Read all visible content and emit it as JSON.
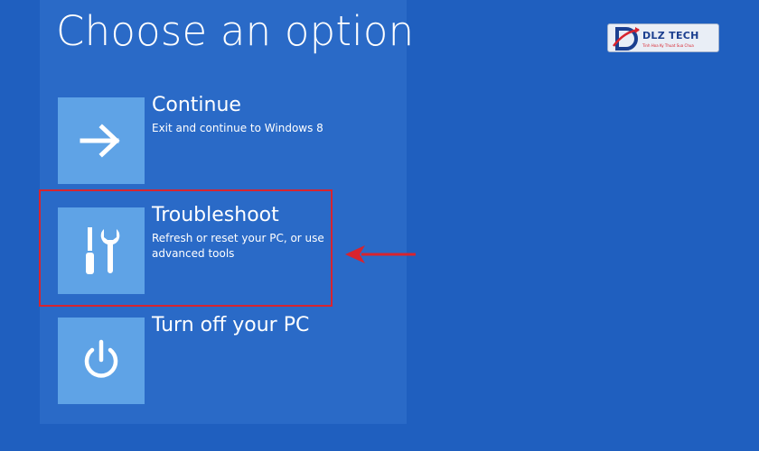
{
  "page": {
    "title": "Choose an option"
  },
  "options": [
    {
      "title": "Continue",
      "description": "Exit and continue to Windows 8",
      "icon": "arrow-right-icon"
    },
    {
      "title": "Troubleshoot",
      "description": "Refresh or reset your PC, or use advanced tools",
      "icon": "tools-icon"
    },
    {
      "title": "Turn off your PC",
      "description": "",
      "icon": "power-icon"
    }
  ],
  "watermark": {
    "brand": "DLZ TECH",
    "tagline": "Tinh Hoa Ky Thuat Sua Chua"
  },
  "colors": {
    "background": "#1f5fbf",
    "panel": "#2a6ac7",
    "tile": "#5fa3e6",
    "annotation": "#d8242e"
  }
}
